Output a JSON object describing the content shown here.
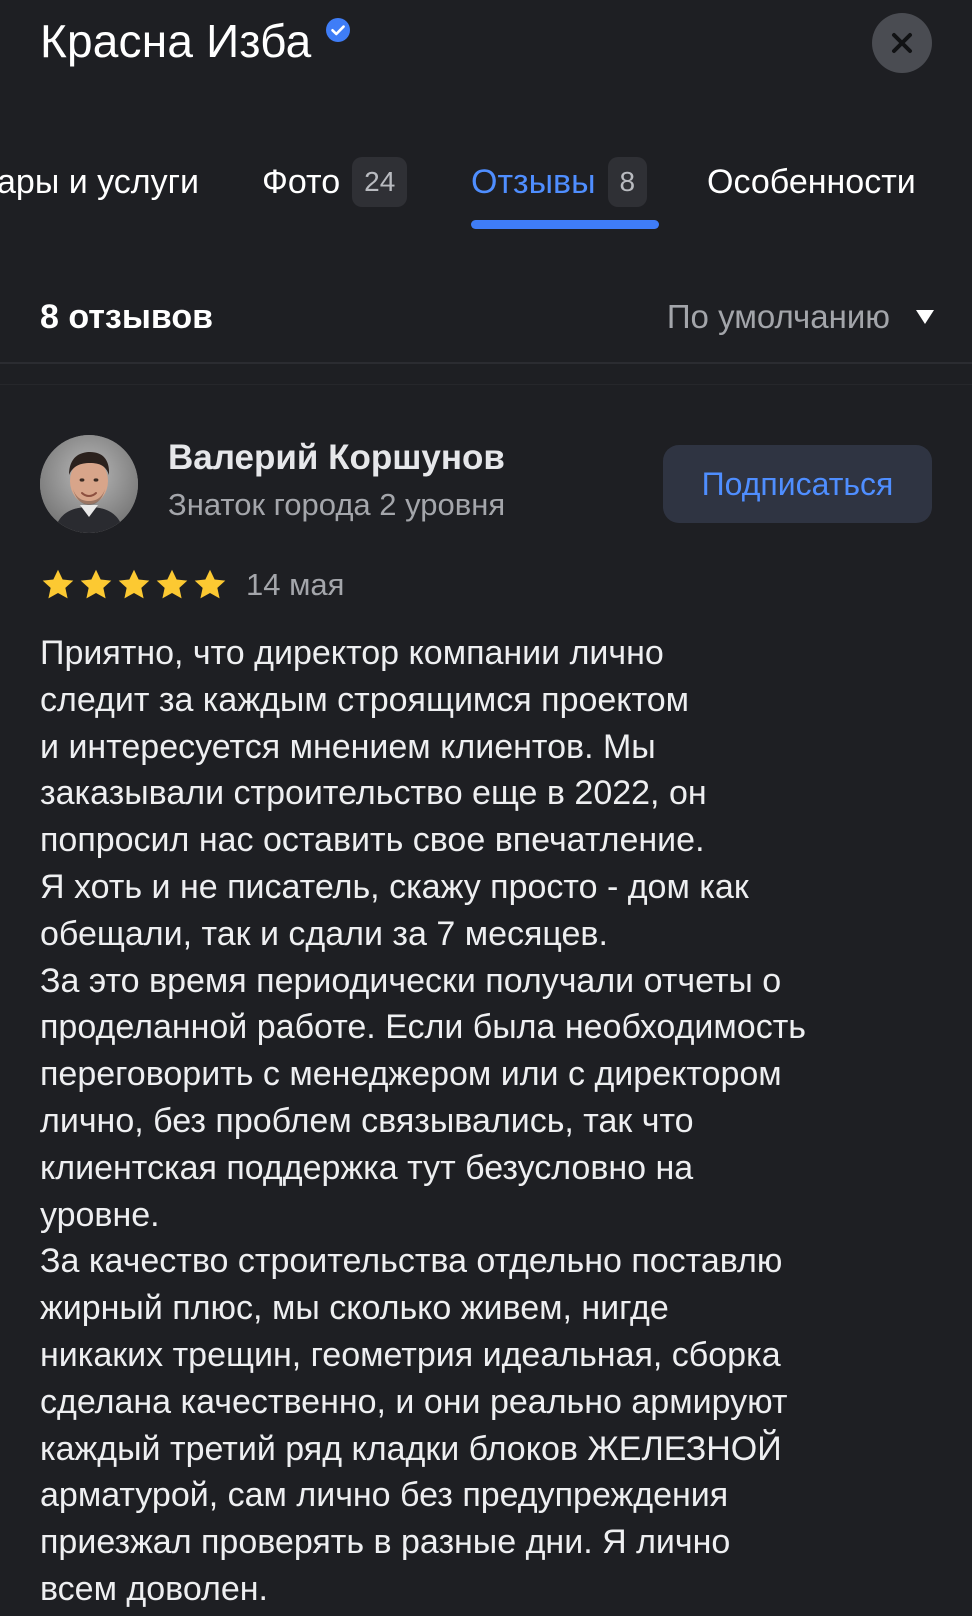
{
  "header": {
    "title": "Красна Изба",
    "verified_icon": "verified-check-icon",
    "close_icon": "close-icon"
  },
  "tabs": [
    {
      "label": "Товары и услуги",
      "visible_label": "ары и услуги",
      "count": null,
      "active": false
    },
    {
      "label": "Фото",
      "count": "24",
      "active": false
    },
    {
      "label": "Отзывы",
      "count": "8",
      "active": true
    },
    {
      "label": "Особенности",
      "count": null,
      "active": false
    }
  ],
  "reviews": {
    "count_label": "8 отзывов",
    "sort_label": "По умолчанию"
  },
  "review": {
    "author": "Валерий Коршунов",
    "level": "Знаток города 2 уровня",
    "subscribe_label": "Подписаться",
    "rating": 5,
    "rating_max": 5,
    "date": "14 мая",
    "text": "Приятно, что директор компании лично\nследит за каждым строящимся проектом\nи интересуется мнением клиентов. Мы\nзаказывали строительство еще в 2022, он\nпопросил нас оставить свое впечатление.\nЯ хоть и не писатель, скажу просто - дом как\nобещали, так и сдали за 7 месяцев.\nЗа это время периодически получали отчеты о\nпроделанной работе. Если была необходимость\nпереговорить с менеджером или с директором\nлично, без проблем связывались, так что\nклиентская поддержка тут безусловно на\nуровне.\nЗа качество строительства отдельно поставлю\nжирный плюс, мы сколько живем, нигде\nникаких трещин, геометрия идеальная, сборка\nсделана качественно, и они реально армируют\nкаждый третий ряд кладки блоков ЖЕЛЕЗНОЙ\nарматурой, сам лично без предупреждения\nприезжал проверять в разные дни. Я лично\nвсем доволен."
  },
  "colors": {
    "background": "#1e1f23",
    "accent": "#4f8eff",
    "star": "#fcc932",
    "verified": "#3f7df7"
  }
}
